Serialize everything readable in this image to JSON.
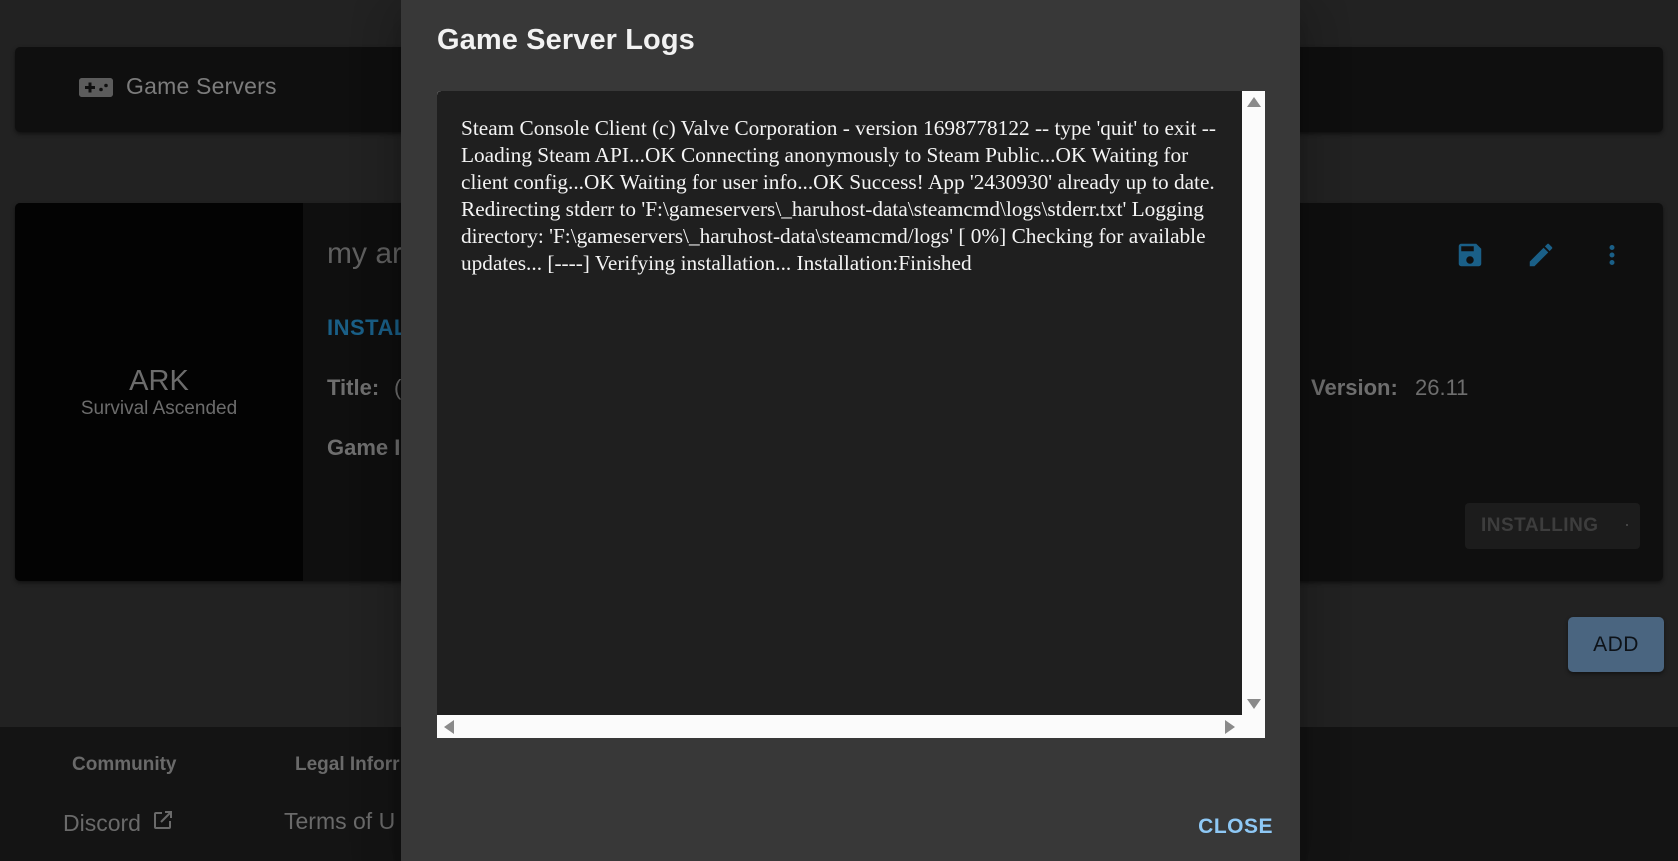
{
  "header": {
    "icon": "gamepad-icon",
    "title": "Game Servers"
  },
  "server_card": {
    "game": {
      "name": "ARK",
      "subtitle": "Survival Ascended"
    },
    "name_partial": "my ar",
    "status_partial": "INSTAL",
    "fields": {
      "title_label": "Title:",
      "title_value_partial": "(",
      "game_label_partial": "Game I",
      "version_label": "Version:",
      "version_value": "26.11"
    },
    "actions": {
      "save_icon": "save-icon",
      "edit_icon": "edit-icon",
      "more_icon": "more-vert-icon"
    },
    "installing_label": "INSTALLING"
  },
  "add_label": "ADD",
  "footer": {
    "community_heading": "Community",
    "legal_heading_partial": "Legal Inforr",
    "discord_label": "Discord",
    "terms_partial": "Terms of U"
  },
  "dialog": {
    "title": "Game Server Logs",
    "log_text": "Steam Console Client (c) Valve Corporation - version 1698778122 -- type 'quit' to exit -- Loading Steam API...OK Connecting anonymously to Steam Public...OK Waiting for client config...OK Waiting for user info...OK Success! App '2430930' already up to date. Redirecting stderr to 'F:\\gameservers\\_haruhost-data\\steamcmd\\logs\\stderr.txt' Logging directory: 'F:\\gameservers\\_haruhost-data\\steamcmd/logs' [ 0%] Checking for available updates... [----] Verifying installation... Installation:Finished",
    "close_label": "CLOSE"
  },
  "colors": {
    "accent": "#8ec8f5",
    "status_blue": "#1a5f87",
    "add_button": "#4a6580"
  }
}
